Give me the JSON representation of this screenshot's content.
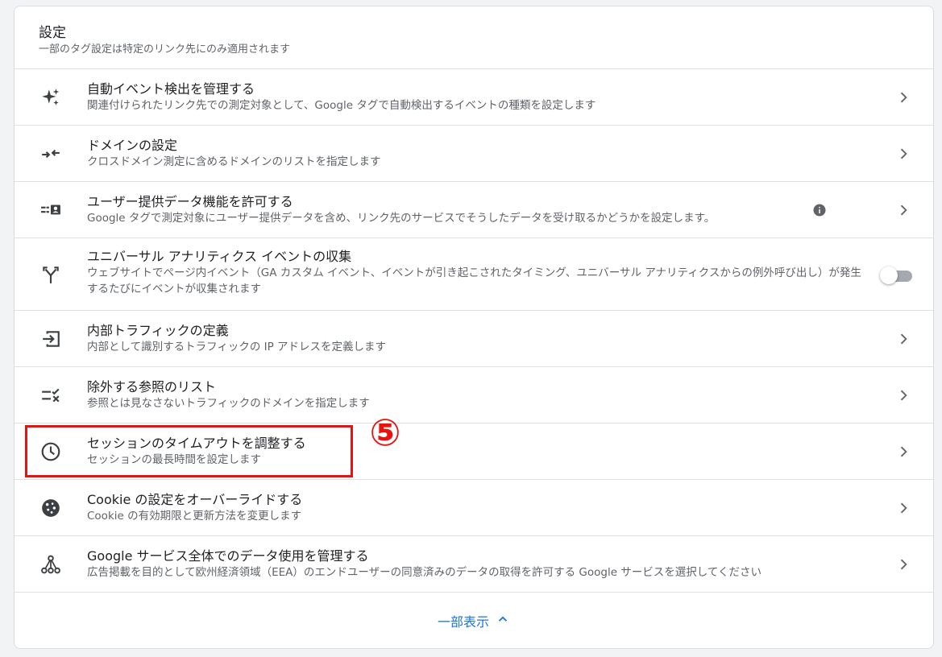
{
  "header": {
    "title": "設定",
    "subtitle": "一部のタグ設定は特定のリンク先にのみ適用されます"
  },
  "rows": [
    {
      "label": "自動イベント検出を管理する",
      "desc": "関連付けられたリンク先での測定対象として、Google タグで自動検出するイベントの種類を設定します",
      "icon": "sparkle-icon"
    },
    {
      "label": "ドメインの設定",
      "desc": "クロスドメイン測定に含めるドメインのリストを指定します",
      "icon": "merge-arrows-icon"
    },
    {
      "label": "ユーザー提供データ機能を許可する",
      "desc": "Google タグで測定対象にユーザー提供データを含め、リンク先のサービスでそうしたデータを受け取るかどうかを設定します。",
      "icon": "contact-card-icon"
    },
    {
      "label": "ユニバーサル アナリティクス イベントの収集",
      "desc": "ウェブサイトでページ内イベント（GA カスタム イベント、イベントが引き起こされたタイミング、ユニバーサル アナリティクスからの例外呼び出し）が発生するたびにイベントが収集されます",
      "icon": "fork-icon"
    },
    {
      "label": "内部トラフィックの定義",
      "desc": "内部として識別するトラフィックの IP アドレスを定義します",
      "icon": "login-arrow-icon"
    },
    {
      "label": "除外する参照のリスト",
      "desc": "参照とは見なさないトラフィックのドメインを指定します",
      "icon": "list-exclude-icon"
    },
    {
      "label": "セッションのタイムアウトを調整する",
      "desc": "セッションの最長時間を設定します",
      "icon": "clock-icon"
    },
    {
      "label": "Cookie の設定をオーバーライドする",
      "desc": "Cookie の有効期限と更新方法を変更します",
      "icon": "cookie-icon"
    },
    {
      "label": "Google サービス全体でのデータ使用を管理する",
      "desc": "広告掲載を目的として欧州経済領域（EEA）のエンドユーザーの同意済みのデータの取得を許可する Google サービスを選択してください",
      "icon": "network-icon"
    }
  ],
  "footer": {
    "show_less_label": "一部表示"
  },
  "annotation": {
    "number": "⑤"
  },
  "colors": {
    "accent": "#1a73e8",
    "highlight": "#e8130f",
    "icon": "#3c4043"
  },
  "toggle": {
    "ua_collection_on": false
  }
}
